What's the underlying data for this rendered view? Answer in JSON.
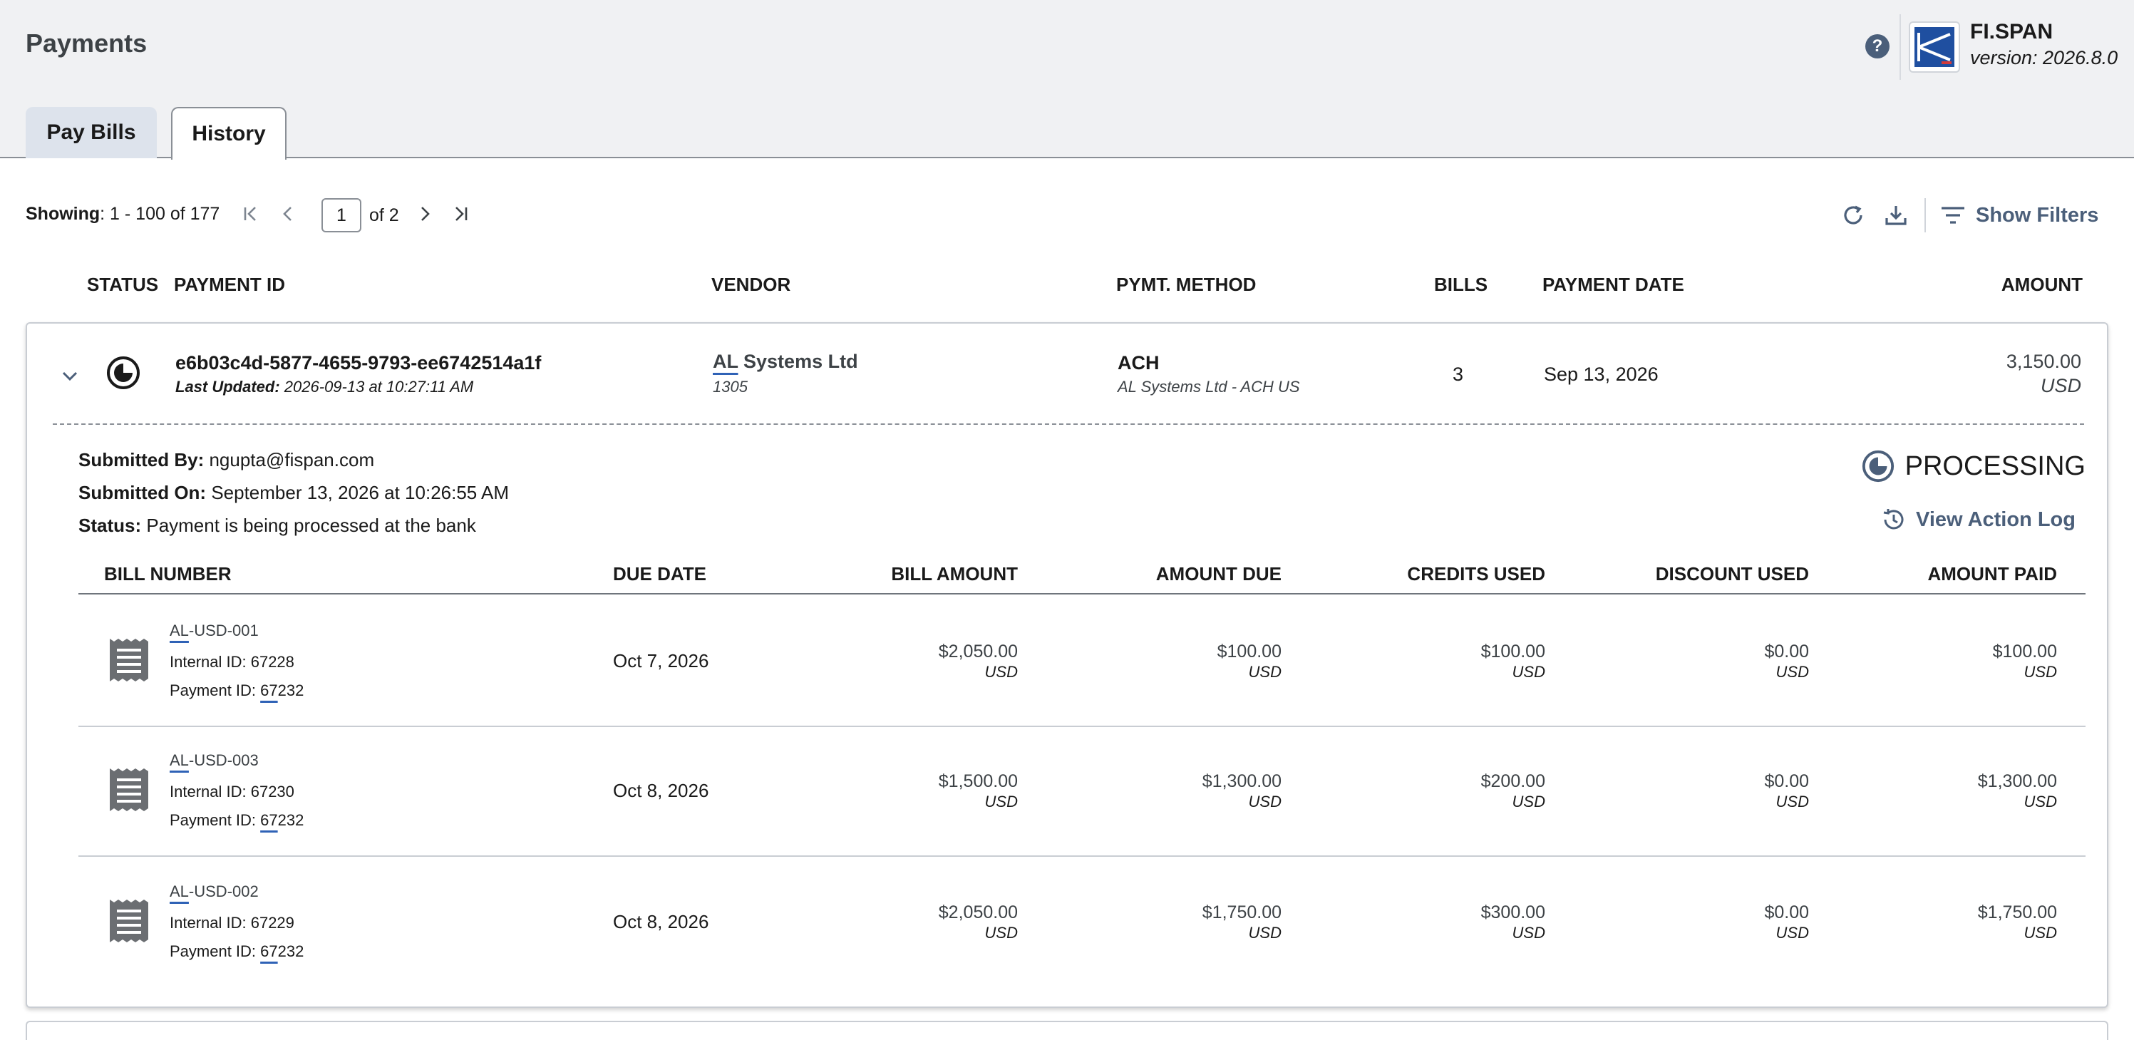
{
  "header": {
    "title": "Payments",
    "help_icon": "?",
    "brand_name": "FI.SPAN",
    "version": "version: 2026.8.0"
  },
  "tabs": [
    {
      "label": "Pay Bills",
      "active": false
    },
    {
      "label": "History",
      "active": true
    }
  ],
  "toolbar": {
    "showing_label": "Showing",
    "showing_range": ": 1 - 100 of 177",
    "page_value": "1",
    "page_of": "of 2",
    "show_filters": "Show Filters"
  },
  "columns": {
    "status": "STATUS",
    "payment_id": "PAYMENT ID",
    "vendor": "VENDOR",
    "method": "PYMT. METHOD",
    "bills": "BILLS",
    "payment_date": "PAYMENT DATE",
    "amount": "AMOUNT"
  },
  "payment": {
    "id": "e6b03c4d-5877-4655-9793-ee6742514a1f",
    "last_updated_label": "Last Updated:",
    "last_updated": " 2026-09-13 at 10:27:11 AM",
    "vendor_prefix": "AL",
    "vendor_rest": " Systems Ltd",
    "vendor_id": "1305",
    "method": "ACH",
    "method_detail": "AL Systems Ltd - ACH US",
    "bills": "3",
    "date": "Sep 13, 2026",
    "amount": "3,150.00",
    "currency": "USD",
    "submitted_by_label": "Submitted By:",
    "submitted_by": " ngupta@fispan.com",
    "submitted_on_label": "Submitted On:",
    "submitted_on": " September 13, 2026 at 10:26:55 AM",
    "status_label": "Status:",
    "status_text": " Payment is being processed at the bank",
    "status_badge": "PROCESSING",
    "view_action_log": "View Action Log"
  },
  "bill_columns": {
    "bill_number": "BILL NUMBER",
    "due_date": "DUE DATE",
    "bill_amount": "BILL AMOUNT",
    "amount_due": "AMOUNT DUE",
    "credits_used": "CREDITS USED",
    "discount_used": "DISCOUNT USED",
    "amount_paid": "AMOUNT PAID"
  },
  "bills": [
    {
      "prefix": "AL",
      "suffix": "-USD-001",
      "internal_id": "Internal ID: 67228",
      "payment_id_label": "Payment ID: ",
      "payment_id_a": "67",
      "payment_id_b": "232",
      "due_date": "Oct 7, 2026",
      "bill_amount": "$2,050.00",
      "amount_due": "$100.00",
      "credits_used": "$100.00",
      "discount_used": "$0.00",
      "amount_paid": "$100.00",
      "currency": "USD"
    },
    {
      "prefix": "AL",
      "suffix": "-USD-003",
      "internal_id": "Internal ID: 67230",
      "payment_id_label": "Payment ID: ",
      "payment_id_a": "67",
      "payment_id_b": "232",
      "due_date": "Oct 8, 2026",
      "bill_amount": "$1,500.00",
      "amount_due": "$1,300.00",
      "credits_used": "$200.00",
      "discount_used": "$0.00",
      "amount_paid": "$1,300.00",
      "currency": "USD"
    },
    {
      "prefix": "AL",
      "suffix": "-USD-002",
      "internal_id": "Internal ID: 67229",
      "payment_id_label": "Payment ID: ",
      "payment_id_a": "67",
      "payment_id_b": "232",
      "due_date": "Oct 8, 2026",
      "bill_amount": "$2,050.00",
      "amount_due": "$1,750.00",
      "credits_used": "$300.00",
      "discount_used": "$0.00",
      "amount_paid": "$1,750.00",
      "currency": "USD"
    }
  ],
  "colors": {
    "accent": "#4b5f7a",
    "link_underline": "#2f62b6",
    "header_bg": "#f0f1f3"
  }
}
